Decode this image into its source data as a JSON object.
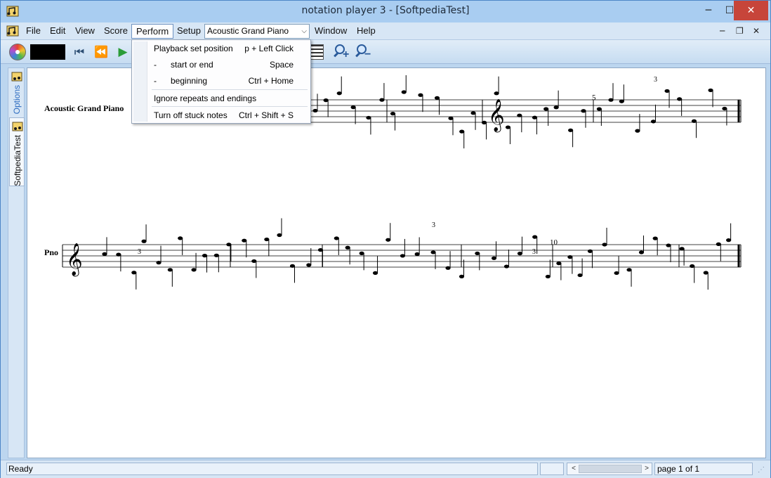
{
  "window": {
    "title": "notation player 3 - [SoftpediaTest]",
    "minimize_glyph": "─",
    "maximize_glyph": "☐",
    "close_glyph": "✕"
  },
  "menubar": {
    "items": [
      "File",
      "Edit",
      "View",
      "Score",
      "Perform",
      "Setup",
      "Window",
      "Help"
    ],
    "active": "Perform",
    "instrument_select": {
      "value": "Acoustic Grand Piano",
      "arrow": "⌵"
    },
    "mdi_min": "─",
    "mdi_restore": "❐",
    "mdi_close": "✕"
  },
  "toolbar": {
    "skip_start_glyph": "⏮",
    "rewind_glyph": "⏪",
    "play_glyph": "▶",
    "zoom_in_sign": "+",
    "zoom_out_sign": "−"
  },
  "perform_menu": {
    "items": [
      {
        "label": "Playback set position",
        "shortcut": "p + Left Click"
      },
      {
        "label": "start or end",
        "prefix": "-",
        "shortcut": "Space"
      },
      {
        "label": "beginning",
        "prefix": "-",
        "shortcut": "Ctrl + Home"
      },
      {
        "label": "Ignore repeats and endings",
        "shortcut": ""
      },
      {
        "label": "Turn off stuck notes",
        "shortcut": "Ctrl + Shift + S"
      }
    ]
  },
  "side_tabs": {
    "options": "Options",
    "document": "SoftpediaTest"
  },
  "score": {
    "staff1_label": "Acoustic Grand Piano",
    "staff2_label": "Pno",
    "measure_numbers": [
      "5",
      "10"
    ],
    "tuplet_marks": [
      "3",
      "3",
      "3",
      "3",
      "3"
    ]
  },
  "status_bar": {
    "ready": "Ready",
    "page": "page 1 of 1",
    "scroll_left": "<",
    "scroll_right": ">",
    "grip": "⋰"
  },
  "colors": {
    "title_bar": "#a9cdf1",
    "close_button": "#c7453a",
    "menu_bar": "#d7e6f5",
    "play_green": "#2a9c37"
  }
}
